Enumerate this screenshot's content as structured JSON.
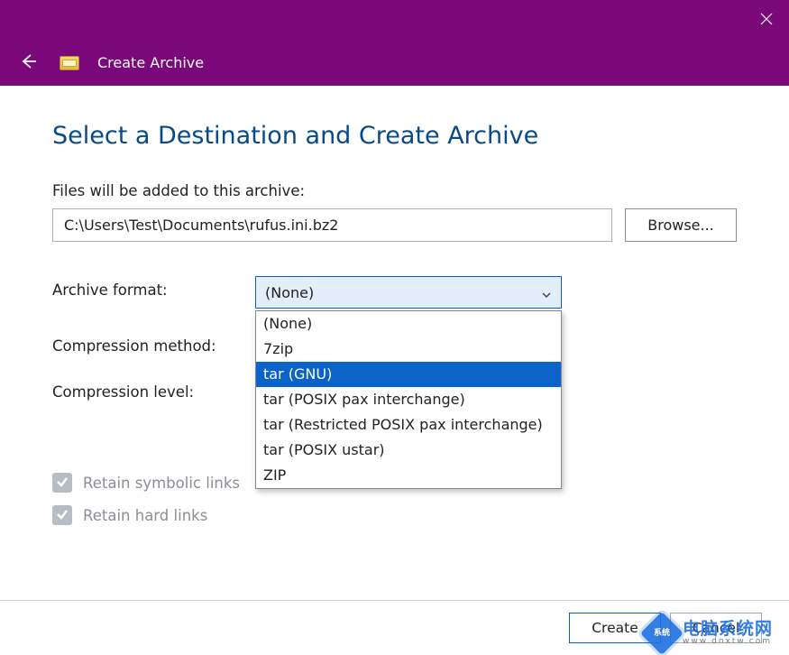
{
  "header": {
    "window_title": "Create Archive"
  },
  "main": {
    "heading": "Select a Destination and Create Archive",
    "path_label": "Files will be added to this archive:",
    "path_value": "C:\\Users\\Test\\Documents\\rufus.ini.bz2",
    "browse_label": "Browse...",
    "rows": {
      "format_label": "Archive format:",
      "method_label": "Compression method:",
      "level_label": "Compression level:"
    },
    "format_selected": "(None)",
    "format_options": [
      "(None)",
      "7zip",
      "tar (GNU)",
      "tar (POSIX pax interchange)",
      "tar (Restricted POSIX pax interchange)",
      "tar (POSIX ustar)",
      "ZIP"
    ],
    "format_highlighted_index": 2,
    "checks": {
      "symbolic": "Retain symbolic links",
      "hard": "Retain hard links"
    }
  },
  "footer": {
    "create": "Create",
    "cancel": "Cancel"
  },
  "watermark": {
    "cn": "电脑系统网",
    "url": "www.dnxtw.com"
  }
}
